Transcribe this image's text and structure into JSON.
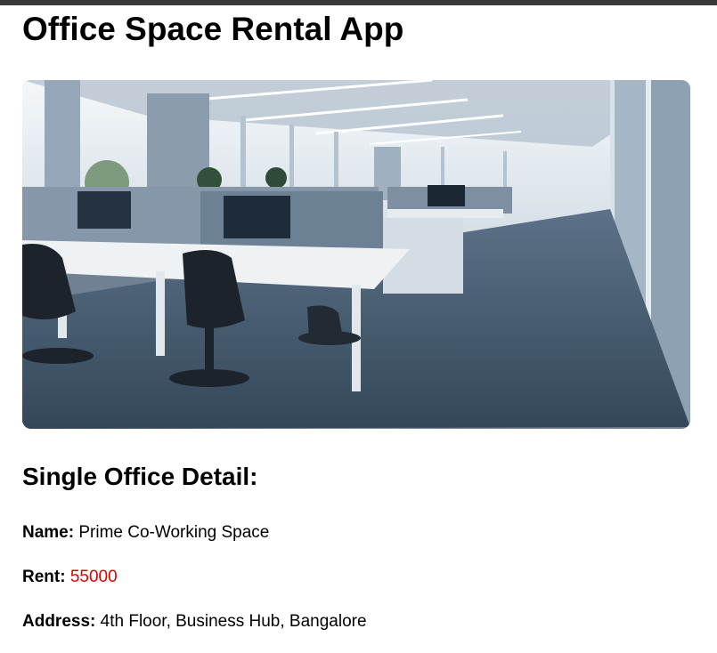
{
  "app": {
    "title": "Office Space Rental App"
  },
  "image": {
    "description_icon": "office-interior-photo"
  },
  "detail": {
    "heading": "Single Office Detail:",
    "name_label": "Name:",
    "name_value": "Prime Co-Working Space",
    "rent_label": "Rent:",
    "rent_value": "55000",
    "address_label": "Address:",
    "address_value": "4th Floor, Business Hub, Bangalore"
  },
  "colors": {
    "rent_value": "#e00000",
    "top_bar": "#3a3a3a"
  }
}
